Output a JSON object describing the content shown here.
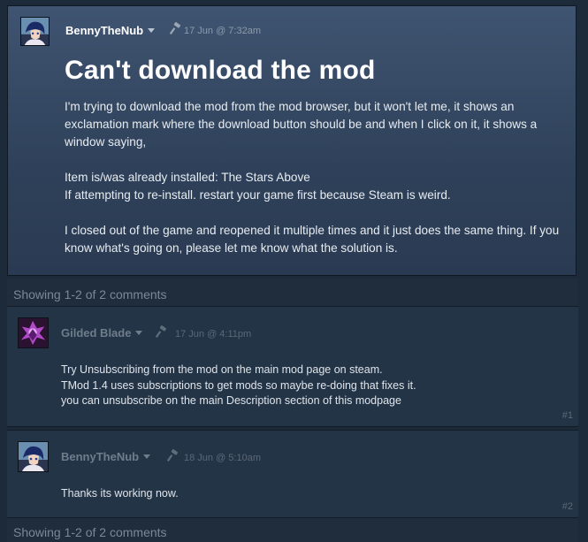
{
  "post": {
    "author": "BennyTheNub",
    "date": "17 Jun @ 7:32am",
    "title": "Can't download the mod",
    "paragraph1": "I'm trying to download the mod from the mod browser, but it won't let me, it shows an exclamation mark where the download button should be and when I click on it, it shows a window saying,",
    "quote_line1": "Item is/was already installed: The Stars Above",
    "quote_line2": "If attempting to re-install. restart your game first because Steam is weird.",
    "paragraph3": "I closed out of the game and reopened it multiple times and it just does the same thing. If you know what's going on, please let me know what the solution is."
  },
  "showing_top": "Showing 1-2 of 2 comments",
  "showing_bottom": "Showing 1-2 of 2 comments",
  "comments": [
    {
      "author": "Gilded Blade",
      "date": "17 Jun @ 4:11pm",
      "lines": [
        "Try Unsubscribing from the mod on the main mod page on steam.",
        "TMod 1.4 uses subscriptions to get mods so maybe re-doing that fixes it.",
        "you can unsubscribe on the main Description section of this modpage"
      ],
      "number": "#1"
    },
    {
      "author": "BennyTheNub",
      "date": "18 Jun @ 5:10am",
      "lines": [
        "Thanks its working now."
      ],
      "number": "#2"
    }
  ],
  "colors": {
    "author_active": "#ffffff",
    "author_muted": "#6f7d8b",
    "background": "#1d2a3a"
  }
}
